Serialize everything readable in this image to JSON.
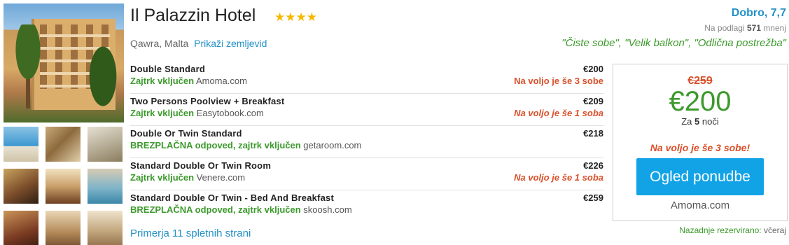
{
  "hotel": {
    "name": "Il Palazzin Hotel",
    "stars": "★★★★",
    "location": "Qawra, Malta",
    "map_link": "Prikaži zemljevid"
  },
  "review": {
    "rating_text": "Dobro, 7,7",
    "reviews_prefix": "Na podlagi",
    "reviews_count": "571",
    "reviews_suffix": "mnenj",
    "quotes": "\"Čiste sobe\", \"Velik balkon\", \"Odlična postrežba\""
  },
  "offers": [
    {
      "room": "Double Standard",
      "perk": "Zajtrk vključen",
      "site": "Amoma.com",
      "price": "€200",
      "availability": "Na voljo je še 3 sobe"
    },
    {
      "room": "Two Persons Poolview + Breakfast",
      "perk": "Zajtrk vključen",
      "site": "Easytobook.com",
      "price": "€209",
      "availability": "Na voljo je še 1 soba"
    },
    {
      "room": "Double Or Twin Standard",
      "perk": "BREZPLAČNA odpoved, zajtrk vključen",
      "site": "getaroom.com",
      "price": "€218",
      "availability": ""
    },
    {
      "room": "Standard Double Or Twin Room",
      "perk": "Zajtrk vključen",
      "site": "Venere.com",
      "price": "€226",
      "availability": "Na voljo je še 1 soba"
    },
    {
      "room": "Standard Double Or Twin - Bed And Breakfast",
      "perk": "BREZPLAČNA odpoved, zajtrk vključen",
      "site": "skoosh.com",
      "price": "€259",
      "availability": ""
    }
  ],
  "compare_link": "Primerja 11 spletnih strani",
  "deal": {
    "old_price": "€259",
    "new_price": "€200",
    "nights_prefix": "Za",
    "nights_count": "5",
    "nights_suffix": "noči",
    "availability": "Na voljo je še 3 sobe!",
    "button": "Ogled ponudbe",
    "site": "Amoma.com"
  },
  "last_booked": {
    "label": "Nazadnje rezervirano:",
    "when": "včeraj"
  },
  "colors": {
    "link_blue": "#2291c8",
    "green": "#3c9a2c",
    "alert_orange": "#d9502a",
    "button_blue": "#12a3e6",
    "star_gold": "#f5b800"
  }
}
